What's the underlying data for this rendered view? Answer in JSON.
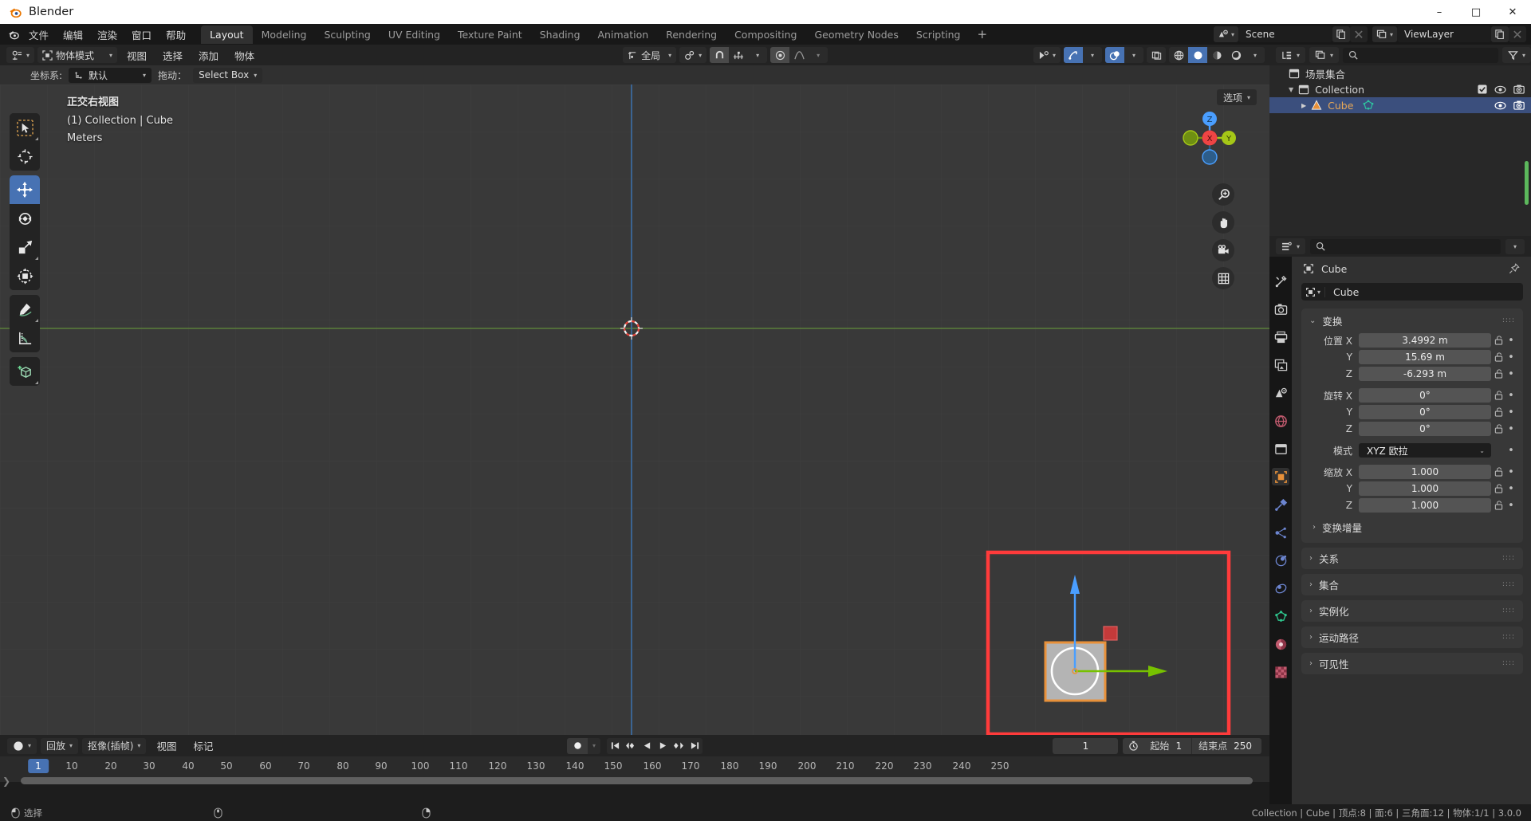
{
  "window": {
    "title": "Blender",
    "minimize": "–",
    "maximize": "□",
    "close": "✕"
  },
  "topbar": {
    "menus": [
      "文件",
      "编辑",
      "渲染",
      "窗口",
      "帮助"
    ],
    "workspaces": [
      {
        "label": "Layout",
        "active": true
      },
      {
        "label": "Modeling",
        "active": false
      },
      {
        "label": "Sculpting",
        "active": false
      },
      {
        "label": "UV Editing",
        "active": false
      },
      {
        "label": "Texture Paint",
        "active": false
      },
      {
        "label": "Shading",
        "active": false
      },
      {
        "label": "Animation",
        "active": false
      },
      {
        "label": "Rendering",
        "active": false
      },
      {
        "label": "Compositing",
        "active": false
      },
      {
        "label": "Geometry Nodes",
        "active": false
      },
      {
        "label": "Scripting",
        "active": false
      }
    ],
    "add_workspace": "+",
    "scene_name": "Scene",
    "viewlayer_name": "ViewLayer"
  },
  "viewport_header": {
    "editor_type": "editor-type-icon",
    "mode": "物体模式",
    "menus": [
      "视图",
      "选择",
      "添加",
      "物体"
    ],
    "transform_orientation": "全局",
    "options_label": "选项"
  },
  "tool_settings": {
    "orientation_label": "坐标系:",
    "orientation_value": "默认",
    "drag_label": "拖动：",
    "drag_value": "Select Box"
  },
  "viewport": {
    "view_name": "正交右视图",
    "collection_object": "(1) Collection | Cube",
    "units": "Meters",
    "gizmo_axes": {
      "x": "X",
      "y": "Y",
      "z": "Z"
    },
    "tools": [
      {
        "name": "tweak-tool",
        "active": false
      },
      {
        "name": "cursor-tool",
        "active": false
      },
      {
        "name": "move-tool",
        "active": true
      },
      {
        "name": "rotate-tool",
        "active": false
      },
      {
        "name": "scale-tool",
        "active": false
      },
      {
        "name": "transform-tool",
        "active": false
      },
      {
        "name": "annotate-tool",
        "active": false
      },
      {
        "name": "measure-tool",
        "active": false
      },
      {
        "name": "add-cube-tool",
        "active": false
      }
    ],
    "selection_box_color": "#ff3b3b",
    "object_outline_color": "#e8913a",
    "gizmo_z_color": "#4a9eff",
    "gizmo_y_color": "#77c100"
  },
  "outliner": {
    "display_mode": "view-layer-icon",
    "search_placeholder": "",
    "rows": [
      {
        "label": "场景集合",
        "indent": 0,
        "type": "scene-collection",
        "expandable": false,
        "checkbox": false,
        "eye": false,
        "camera": false,
        "selected": false
      },
      {
        "label": "Collection",
        "indent": 1,
        "type": "collection",
        "expandable": true,
        "checkbox": true,
        "eye": true,
        "camera": true,
        "selected": false
      },
      {
        "label": "Cube",
        "indent": 2,
        "type": "mesh-object",
        "expandable": true,
        "checkbox": false,
        "eye": true,
        "camera": true,
        "selected": true
      }
    ]
  },
  "properties": {
    "breadcrumb_object": "Cube",
    "object_name": "Cube",
    "transform_panel": {
      "title": "变换",
      "rows": [
        {
          "label": "位置 X",
          "value": "3.4992 m"
        },
        {
          "label": "Y",
          "value": "15.69 m"
        },
        {
          "label": "Z",
          "value": "-6.293 m"
        },
        {
          "label": "旋转 X",
          "value": "0°"
        },
        {
          "label": "Y",
          "value": "0°"
        },
        {
          "label": "Z",
          "value": "0°"
        }
      ],
      "mode_label": "模式",
      "mode_value": "XYZ 欧拉",
      "scale_rows": [
        {
          "label": "缩放 X",
          "value": "1.000"
        },
        {
          "label": "Y",
          "value": "1.000"
        },
        {
          "label": "Z",
          "value": "1.000"
        }
      ],
      "delta_transform": "变换增量"
    },
    "collapsed_panels": [
      "关系",
      "集合",
      "实例化",
      "运动路径",
      "可见性"
    ],
    "tabs": [
      {
        "name": "tool-tab",
        "active": false
      },
      {
        "name": "render-tab",
        "active": false
      },
      {
        "name": "output-tab",
        "active": false
      },
      {
        "name": "view-layer-tab",
        "active": false
      },
      {
        "name": "scene-tab",
        "active": false
      },
      {
        "name": "world-tab",
        "active": false
      },
      {
        "name": "collection-tab",
        "active": false
      },
      {
        "name": "object-tab",
        "active": true
      },
      {
        "name": "modifier-tab",
        "active": false
      },
      {
        "name": "particles-tab",
        "active": false
      },
      {
        "name": "physics-tab",
        "active": false
      },
      {
        "name": "constraints-tab",
        "active": false
      },
      {
        "name": "data-tab",
        "active": false
      },
      {
        "name": "material-tab",
        "active": false
      },
      {
        "name": "texture-tab",
        "active": false
      }
    ]
  },
  "timeline": {
    "editor_icon": "timeline-editor-icon",
    "menus": [
      "回放",
      "抠像(插帧)",
      "视图",
      "标记"
    ],
    "current_frame": "1",
    "start_label": "起始",
    "start_value": "1",
    "end_label": "结束点",
    "end_value": "250",
    "ticks": [
      "10",
      "20",
      "30",
      "40",
      "50",
      "60",
      "70",
      "80",
      "90",
      "100",
      "110",
      "120",
      "130",
      "140",
      "150",
      "160",
      "170",
      "180",
      "190",
      "200",
      "210",
      "220",
      "230",
      "240",
      "250"
    ],
    "playhead_label": "1"
  },
  "statusbar": {
    "select_label": "选择",
    "info": "Collection | Cube | 顶点:8 | 面:6 | 三角面:12 | 物体:1/1 | 3.0.0"
  }
}
